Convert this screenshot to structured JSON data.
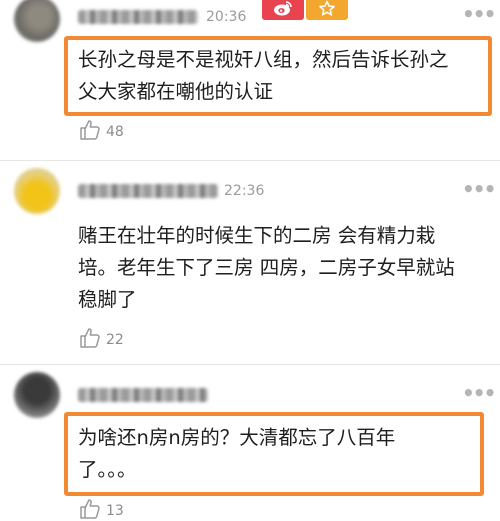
{
  "comments": [
    {
      "time": "20:36",
      "text_line1": "长孙之母是不是视奸八组，然后告诉长孙之",
      "text_line2": "父大家都在嘲他的认证",
      "likes": "48"
    },
    {
      "time": "22:36",
      "text_line1": "赌王在壮年的时候生下的二房 会有精力栽",
      "text_line2": "培。老年生下了三房 四房，二房子女早就站",
      "text_line3": "稳脚了",
      "likes": "22"
    },
    {
      "time": "",
      "text_line1": "为啥还n房n房的？大清都忘了八百年",
      "text_line2": "了。。。",
      "likes": "13"
    }
  ],
  "badges": {
    "weibo_icon": "weibo-icon",
    "star_icon": "star-icon",
    "weibo_color": "#e8434f",
    "star_color": "#f3a72f"
  },
  "colors": {
    "highlight": "#f08a35",
    "meta_text": "#9b9b9b"
  }
}
